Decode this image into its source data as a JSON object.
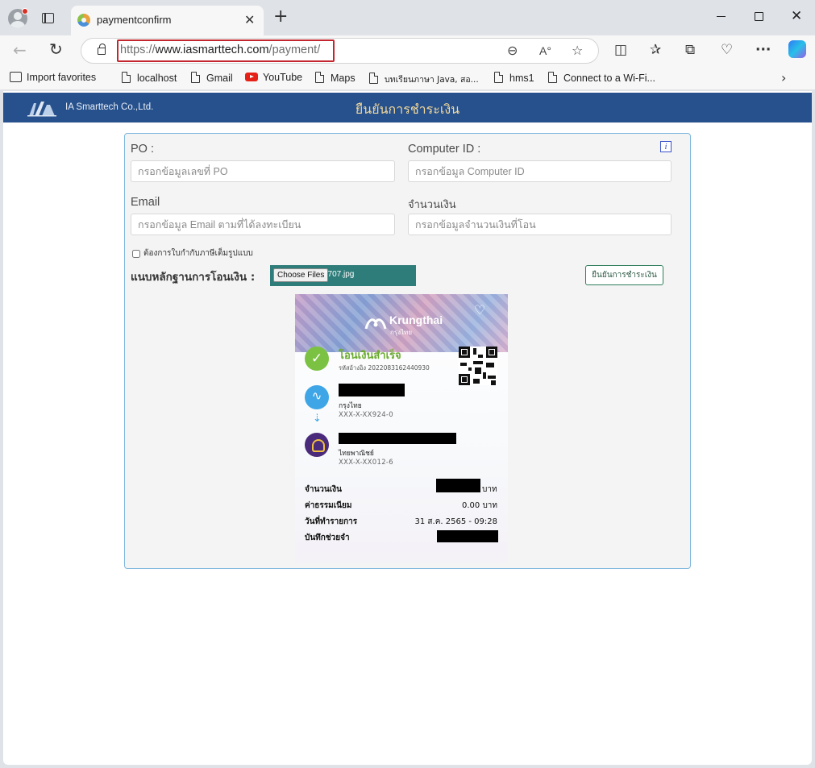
{
  "browser": {
    "tab_title": "paymentconfirm",
    "url_prefix": "https://",
    "url_host": "www.iasmarttech.com",
    "url_path": "/payment/",
    "bookmarks": [
      {
        "label": "Import favorites"
      },
      {
        "label": "localhost"
      },
      {
        "label": "Gmail"
      },
      {
        "label": "YouTube"
      },
      {
        "label": "Maps"
      },
      {
        "label": "บทเรียนภาษา Java, สอ..."
      },
      {
        "label": "hms1"
      },
      {
        "label": "Connect to a Wi-Fi..."
      }
    ]
  },
  "site": {
    "brand": "IA Smarttech Co.,Ltd.",
    "title": "ยืนยันการชำระเงิน",
    "colors": {
      "header": "#27518c",
      "title": "#f3d89a",
      "accent": "#2e7d7a"
    }
  },
  "form": {
    "po": {
      "label": "PO :",
      "placeholder": "กรอกข้อมูลเลขที่ PO"
    },
    "computer_id": {
      "label": "Computer ID :",
      "placeholder": "กรอกข้อมูล Computer ID"
    },
    "email": {
      "label": "Email",
      "placeholder": "กรอกข้อมูล Email ตามที่ได้ลงทะเบียน"
    },
    "amount": {
      "label": "จำนวนเงิน",
      "placeholder": "กรอกข้อมูลจำนวนเงินที่โอน"
    },
    "tax_invoice_label": "ต้องการใบกำกับภาษีเต็มรูปแบบ",
    "attach_label": "แนบหลักฐานการโอนเงิน :",
    "file_button": "Choose Files",
    "file_name": "7707.jpg",
    "confirm_button": "ยืนยันการชำระเงิน",
    "info_icon": "i"
  },
  "receipt": {
    "bank_name": "Krungthai",
    "bank_name_th": "กรุงไทย",
    "status": "โอนเงินสำเร็จ",
    "reference": "รหัสอ้างอิง 2022083162440930",
    "from_bank": "กรุงไทย",
    "from_account": "XXX-X-XX924-0",
    "to_bank": "ไทยพาณิชย์",
    "to_account": "XXX-X-XX012-6",
    "amount_label": "จำนวนเงิน",
    "amount_unit": "บาท",
    "fee_label": "ค่าธรรมเนียม",
    "fee_value": "0.00 บาท",
    "date_label": "วันที่ทำรายการ",
    "date_value": "31 ส.ค. 2565 - 09:28",
    "memo_label": "บันทึกช่วยจำ"
  }
}
